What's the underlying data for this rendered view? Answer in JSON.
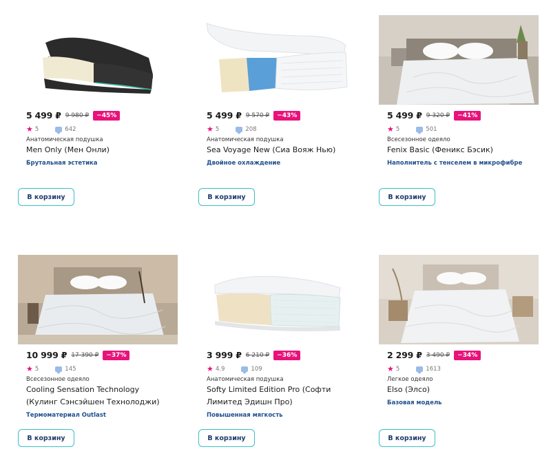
{
  "products": [
    {
      "price": "5 499 ₽",
      "old_price": "9 980 ₽",
      "discount": "−45%",
      "rating": "5",
      "reviews": "642",
      "category": "Анатомическая подушка",
      "name": "Men Only (Мен Онли)",
      "name2": "",
      "feature": "Брутальная эстетика",
      "button": "В корзину",
      "image": "black-pillow"
    },
    {
      "price": "5 499 ₽",
      "old_price": "9 570 ₽",
      "discount": "−43%",
      "rating": "5",
      "reviews": "208",
      "category": "Анатомическая подушка",
      "name": "Sea Voyage New (Сиа Вояж Нью)",
      "name2": "",
      "feature": "Двойное охлаждение",
      "button": "В корзину",
      "image": "white-gel-pillow"
    },
    {
      "price": "5 499 ₽",
      "old_price": "9 320 ₽",
      "discount": "−41%",
      "rating": "5",
      "reviews": "501",
      "category": "Всесезонное одеяло",
      "name": "Fenix Basic (Феникс Бэсик)",
      "name2": "",
      "feature": "Наполнитель с тенселем в микрофибре",
      "button": "В корзину",
      "image": "bedroom-blanket"
    },
    {
      "price": "10 999 ₽",
      "old_price": "17 390 ₽",
      "discount": "−37%",
      "rating": "5",
      "reviews": "145",
      "category": "Всесезонное одеяло",
      "name": "Cooling Sensation Technology",
      "name2": "(Кулинг Сэнсэйшен Технолоджи)",
      "feature": "Термоматериал Outlast",
      "button": "В корзину",
      "image": "bedroom-blanket-warm"
    },
    {
      "price": "3 999 ₽",
      "old_price": "6 210 ₽",
      "discount": "−36%",
      "rating": "4.9",
      "reviews": "109",
      "category": "Анатомическая подушка",
      "name": "Softy Limited Edition Pro (Софти",
      "name2": "Лимитед Эдишн Про)",
      "feature": "Повышенная мягкость",
      "button": "В корзину",
      "image": "white-foam-pillow"
    },
    {
      "price": "2 299 ₽",
      "old_price": "3 490 ₽",
      "discount": "−34%",
      "rating": "5",
      "reviews": "1613",
      "category": "Легкое одеяло",
      "name": "Elso (Элсо)",
      "name2": "",
      "feature": "Базовая модель",
      "button": "В корзину",
      "image": "bedroom-blanket-light"
    }
  ]
}
